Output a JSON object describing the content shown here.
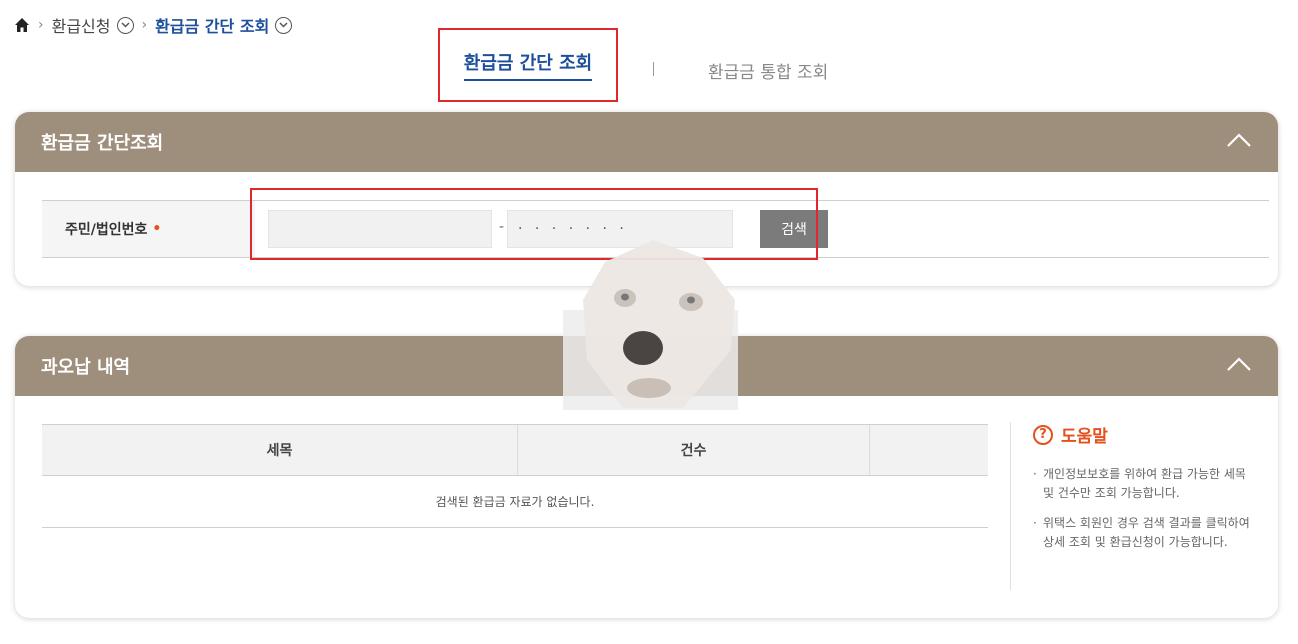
{
  "breadcrumb": {
    "items": [
      "환급신청",
      "환급금 간단 조회"
    ]
  },
  "tabs": [
    {
      "label": "환급금 간단 조회"
    },
    {
      "label": "환급금 통합 조회"
    }
  ],
  "search_panel": {
    "title": "환급금 간단조회",
    "field_label": "주민/법인번호",
    "required_mark": "•",
    "dash": "-",
    "masked_value": "· · · · · · ·",
    "search_button": "검색"
  },
  "result_panel": {
    "title": "과오납 내역",
    "columns": [
      "세목",
      "건수",
      ""
    ],
    "empty_message": "검색된 환급금 자료가 없습니다."
  },
  "help": {
    "title": "도움말",
    "items": [
      "개인정보보호를 위하여 환급 가능한 세목 및 건수만 조회 가능합니다.",
      "위택스 회원인 경우 검색 결과를 클릭하여 상세 조회 및 환급신청이 가능합니다."
    ]
  },
  "colors": {
    "panel_header": "#9e8f7d",
    "link_blue": "#1e4f9c",
    "highlight_red": "#e3262e",
    "help_orange": "#e4511c"
  }
}
